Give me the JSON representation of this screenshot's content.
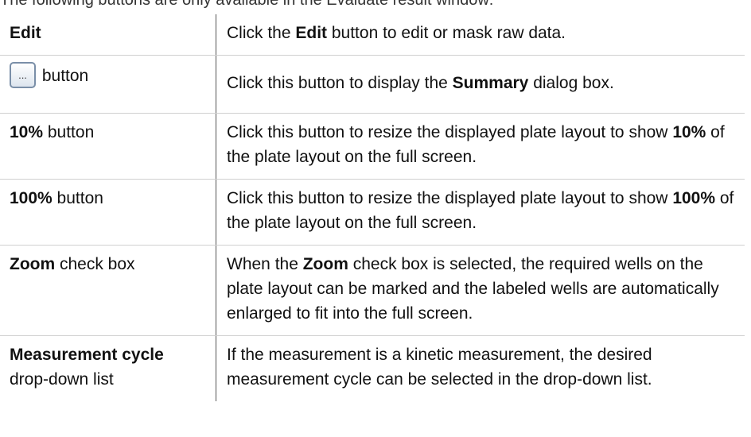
{
  "intro": "The following buttons are only available in the Evaluate result window:",
  "rows": [
    {
      "label_bold": "Edit",
      "label_rest": "",
      "desc_pre": "Click the ",
      "desc_bold": "Edit",
      "desc_post": " button to edit or mask raw data."
    },
    {
      "label_icon": "ellipsis-button-icon",
      "icon_text": "...",
      "label_rest": "button",
      "desc_pre": "Click this button to display the ",
      "desc_bold": "Summary",
      "desc_post": " dialog box."
    },
    {
      "label_bold": "10%",
      "label_rest": " button",
      "desc_pre": "Click this button to resize the displayed plate layout to show ",
      "desc_bold": "10%",
      "desc_post": " of the plate layout on the full screen."
    },
    {
      "label_bold": "100%",
      "label_rest": " button",
      "desc_pre": "Click this button to resize the displayed plate layout to show ",
      "desc_bold": "100%",
      "desc_post": " of the plate layout on the full screen."
    },
    {
      "label_bold": "Zoom",
      "label_rest": " check box",
      "desc_pre": "When the ",
      "desc_bold": "Zoom",
      "desc_post": " check box is selected, the required wells on the plate layout can be marked and the labeled wells are automatically enlarged to fit into the full screen."
    },
    {
      "label_bold": "Measurement cycle",
      "label_rest": "drop-down list",
      "desc_pre": "If the measurement is a kinetic measurement, the desired measurement cycle can be selected in the drop-down list.",
      "desc_bold": "",
      "desc_post": ""
    }
  ]
}
